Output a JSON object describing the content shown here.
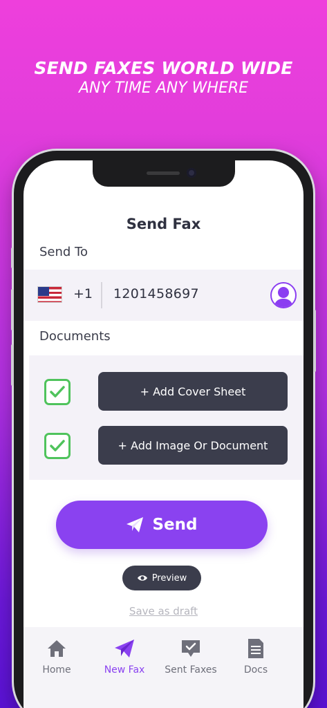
{
  "banner": {
    "line1": "SEND FAXES WORLD WIDE",
    "line2": "ANY TIME ANY WHERE"
  },
  "screen": {
    "title": "Send Fax",
    "send_to_label": "Send To",
    "country_code": "+1",
    "phone_number": "1201458697",
    "documents_label": "Documents",
    "add_cover_sheet": "+ Add Cover Sheet",
    "add_image_or_document": "+ Add Image Or Document",
    "send_label": "Send",
    "preview_label": "Preview",
    "save_draft_label": "Save as draft"
  },
  "tabbar": {
    "items": [
      {
        "label": "Home",
        "icon": "home-icon"
      },
      {
        "label": "New Fax",
        "icon": "paper-plane-icon",
        "active": true
      },
      {
        "label": "Sent Faxes",
        "icon": "chat-check-icon"
      },
      {
        "label": "Docs",
        "icon": "document-icon"
      }
    ]
  },
  "colors": {
    "accent": "#8a42f0",
    "dark_button": "#3b3d4c",
    "check_green": "#4fc35c",
    "bg_top": "#ee3fdc",
    "bg_bottom": "#5a12d4"
  }
}
